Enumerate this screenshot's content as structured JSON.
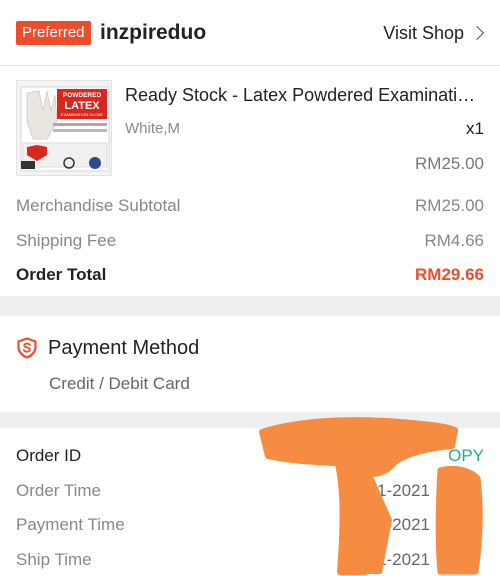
{
  "shop": {
    "badge": "Preferred",
    "name": "inzpireduo",
    "visit_label": "Visit Shop"
  },
  "product": {
    "title": "Ready Stock - Latex Powdered Examinati…",
    "variant": "White,M",
    "quantity": "x1",
    "price": "RM25.00",
    "image_text": [
      "POWDERED",
      "LATEX",
      "EXAMINATION GLOVE"
    ]
  },
  "summary": {
    "subtotal_label": "Merchandise Subtotal",
    "subtotal_value": "RM25.00",
    "shipping_label": "Shipping Fee",
    "shipping_value": "RM4.66",
    "total_label": "Order Total",
    "total_value": "RM29.66"
  },
  "payment": {
    "title": "Payment Method",
    "value": "Credit / Debit Card"
  },
  "order": {
    "id_label": "Order ID",
    "copy_label": "OPY",
    "order_time_label": "Order Time",
    "order_time_value": "-01-2021",
    "payment_time_label": "Payment Time",
    "payment_time_value": "01-2021",
    "ship_time_label": "Ship Time",
    "ship_time_value": "01-2021"
  },
  "colors": {
    "accent": "#ee4d2d",
    "copy": "#26aa99",
    "redaction": "#f58c42"
  },
  "icons": {
    "payment": "shield-dollar-icon",
    "visit_shop": "chevron-right-icon"
  }
}
